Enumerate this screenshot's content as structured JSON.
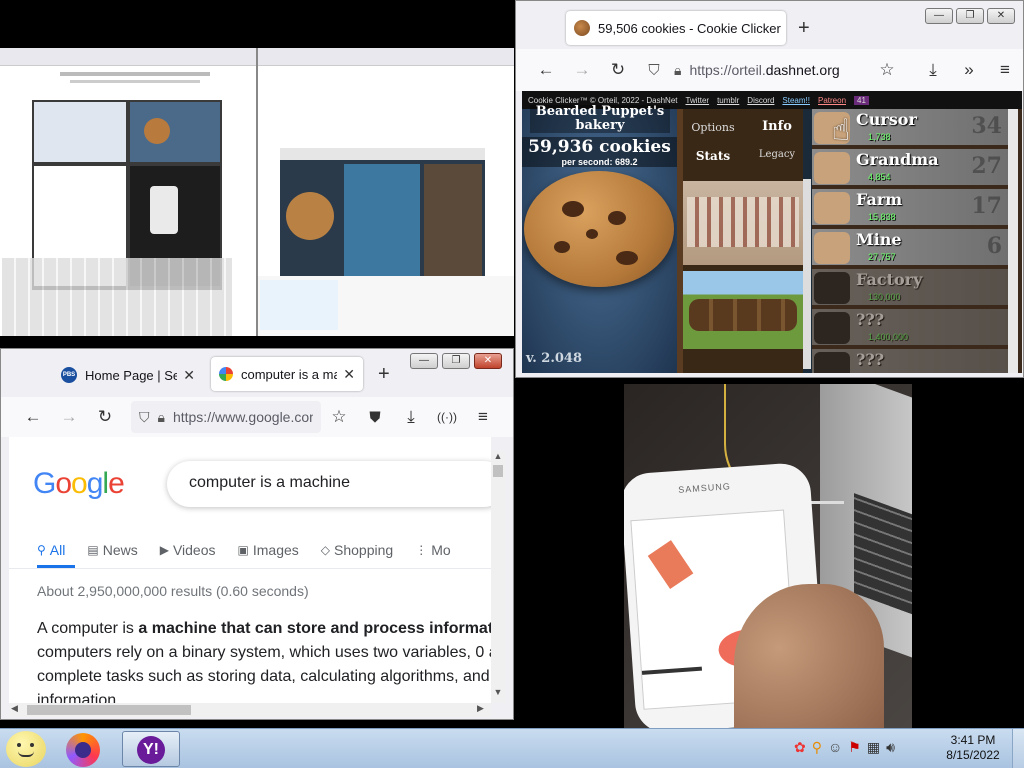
{
  "cookie_window": {
    "tab_title": "59,506 cookies - Cookie Clicker",
    "url_prefix": "https://orteil.",
    "url_domain": "dashnet.org",
    "topbar_items": [
      "Cookie Clicker™ © Orteil, 2022 - DashNet",
      "Twitter",
      "tumblr",
      "Discord",
      "Steam!!",
      "Patreon",
      "41"
    ],
    "bakery_name": "Bearded Puppet's bakery",
    "cookie_count": "59,936 cookies",
    "per_second": "per second: 689.2",
    "version": "v. 2.048",
    "menu": {
      "options": "Options",
      "info": "Info",
      "stats": "Stats",
      "legacy": "Legacy"
    },
    "store": [
      {
        "name": "Cursor",
        "price": "1,738",
        "count": "34",
        "locked": false
      },
      {
        "name": "Grandma",
        "price": "4,854",
        "count": "27",
        "locked": false
      },
      {
        "name": "Farm",
        "price": "15,838",
        "count": "17",
        "locked": false
      },
      {
        "name": "Mine",
        "price": "27,757",
        "count": "6",
        "locked": false
      },
      {
        "name": "Factory",
        "price": "130,000",
        "count": "",
        "locked": true
      },
      {
        "name": "???",
        "price": "1,400,000",
        "count": "",
        "locked": true
      },
      {
        "name": "???",
        "price": "",
        "count": "",
        "locked": true
      }
    ]
  },
  "google_window": {
    "tab1_title": "Home Page | Sesame",
    "tab1_badge": "PBS",
    "tab2_title": "computer is a machine",
    "url": "https://www.google.com",
    "logo_letters": [
      "G",
      "o",
      "o",
      "g",
      "l",
      "e"
    ],
    "search_query": "computer is a machine",
    "search_tabs": [
      {
        "label": "All",
        "icon": "search-icon",
        "active": true
      },
      {
        "label": "News",
        "icon": "news-icon",
        "active": false
      },
      {
        "label": "Videos",
        "icon": "video-icon",
        "active": false
      },
      {
        "label": "Images",
        "icon": "image-icon",
        "active": false
      },
      {
        "label": "Shopping",
        "icon": "tag-icon",
        "active": false
      },
      {
        "label": "Mo",
        "icon": "more-icon",
        "active": false
      }
    ],
    "result_stats": "About 2,950,000,000 results (0.60 seconds)",
    "snippet_line1_plain": "A computer is ",
    "snippet_line1_bold": "a machine that can store and process informat",
    "snippet_line2": "computers rely on a binary system, which uses two variables, 0 a",
    "snippet_line3": "complete tasks such as storing data, calculating algorithms, and",
    "snippet_line4": "information."
  },
  "taskbar": {
    "time": "3:41 PM",
    "date": "8/15/2022",
    "apps": [
      "smiley-app",
      "firefox-app",
      "yahoo-messenger-app"
    ]
  },
  "phone": {
    "brand": "SAMSUNG"
  },
  "colors": {
    "google_blue": "#4285f4",
    "google_red": "#ea4335",
    "google_yellow": "#fbbc05",
    "google_green": "#34a853",
    "taskbar": "#b8d0ea"
  }
}
